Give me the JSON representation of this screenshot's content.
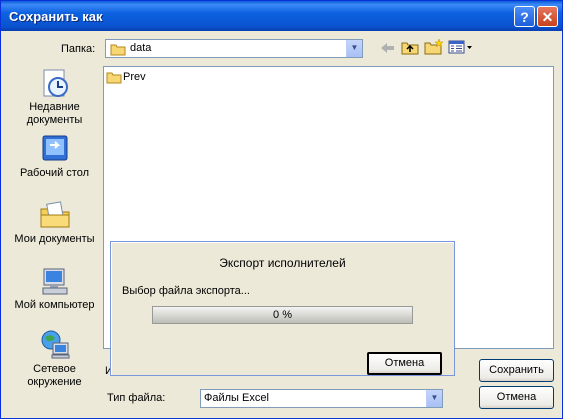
{
  "window": {
    "title": "Сохранить как",
    "help_symbol": "?",
    "close_symbol": "✕"
  },
  "toolbar": {
    "folder_label": "Папка:",
    "folder_value": "data",
    "back_icon": "back-arrow-icon",
    "up_icon": "folder-up-icon",
    "new_folder_icon": "new-folder-icon",
    "views_icon": "views-menu-icon"
  },
  "places": [
    {
      "label": "Недавние документы",
      "icon": "recent-documents-icon"
    },
    {
      "label": "Рабочий стол",
      "icon": "desktop-icon"
    },
    {
      "label": "Мои документы",
      "icon": "my-documents-icon"
    },
    {
      "label": "Мой компьютер",
      "icon": "my-computer-icon"
    },
    {
      "label": "Сетевое окружение",
      "icon": "network-places-icon"
    }
  ],
  "files": [
    {
      "name": "Prev",
      "type": "folder"
    }
  ],
  "bottom": {
    "filename_label_partial": "И",
    "filetype_label": "Тип файла:",
    "filetype_value": "Файлы Excel",
    "save_button": "Сохранить",
    "cancel_button": "Отмена"
  },
  "progress_dialog": {
    "title": "Экспорт исполнителей",
    "message": "Выбор файла экспорта...",
    "percent": 0,
    "percent_text": "0 %",
    "cancel_button": "Отмена"
  },
  "colors": {
    "accent": "#0a52cf",
    "dialog_bg": "#ece9d8",
    "progress_fill": "#2fa12f"
  }
}
